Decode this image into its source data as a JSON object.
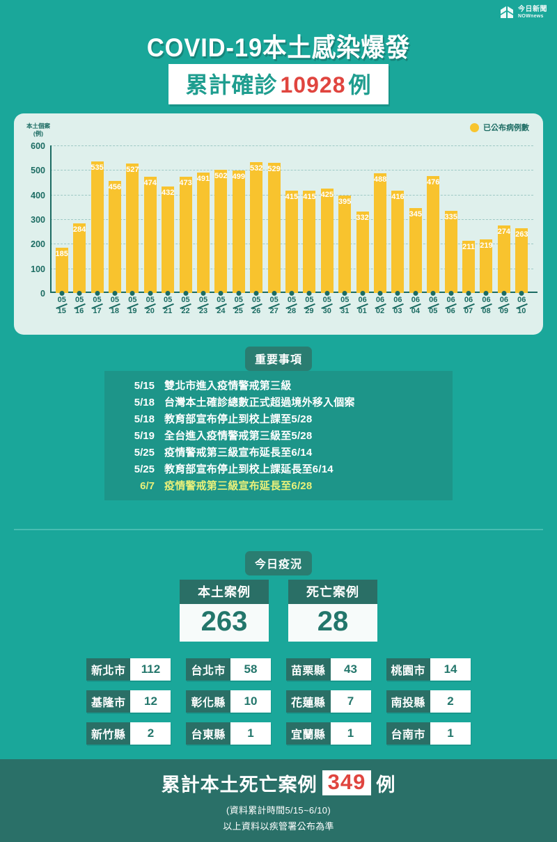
{
  "brand": {
    "logo_cn": "今日新聞",
    "logo_en": "NOWnews"
  },
  "header": {
    "title": "COVID-19本土感染爆發",
    "subtitle_prefix": "累計確診",
    "subtitle_number": "10928",
    "subtitle_suffix": "例",
    "accent_color": "#1f9d8f",
    "highlight_color": "#e0453f"
  },
  "chart_data": {
    "type": "bar",
    "title": "",
    "ylabel": "本土個案",
    "yunit": "(例)",
    "xlabel": "",
    "legend": [
      {
        "label": "已公布病例數",
        "color": "#f8c32e"
      }
    ],
    "legend_position": "top-right",
    "grid": true,
    "ylim": [
      0,
      600
    ],
    "yticks": [
      0,
      100,
      200,
      300,
      400,
      500,
      600
    ],
    "categories": [
      "05/15",
      "05/16",
      "05/17",
      "05/18",
      "05/19",
      "05/20",
      "05/21",
      "05/22",
      "05/23",
      "05/24",
      "05/25",
      "05/26",
      "05/27",
      "05/28",
      "05/29",
      "05/30",
      "05/31",
      "06/01",
      "06/02",
      "06/03",
      "06/04",
      "06/05",
      "06/06",
      "06/07",
      "06/08",
      "06/09",
      "06/10"
    ],
    "values": [
      185,
      284,
      535,
      456,
      527,
      474,
      432,
      473,
      491,
      502,
      499,
      532,
      529,
      415,
      415,
      425,
      395,
      332,
      488,
      416,
      345,
      476,
      335,
      211,
      219,
      274,
      263
    ],
    "bar_color": "#f8c32e",
    "plot_background": "#dff0ec",
    "axis_color": "#1b6b62"
  },
  "events": {
    "heading": "重要事項",
    "rows": [
      {
        "date": "5/15",
        "text": "雙北市進入疫情警戒第三級",
        "highlight": false
      },
      {
        "date": "5/18",
        "text": "台灣本土確診總數正式超過境外移入個案",
        "highlight": false
      },
      {
        "date": "5/18",
        "text": "教育部宣布停止到校上課至5/28",
        "highlight": false
      },
      {
        "date": "5/19",
        "text": "全台進入疫情警戒第三級至5/28",
        "highlight": false
      },
      {
        "date": "5/25",
        "text": "疫情警戒第三級宣布延長至6/14",
        "highlight": false
      },
      {
        "date": "5/25",
        "text": "教育部宣布停止到校上課延長至6/14",
        "highlight": false
      },
      {
        "date": "6/7",
        "text": "疫情警戒第三級宣布延長至6/28",
        "highlight": true
      }
    ],
    "highlight_color": "#e9f07a"
  },
  "today": {
    "heading": "今日疫況",
    "stats": [
      {
        "label": "本土案例",
        "value": "263"
      },
      {
        "label": "死亡案例",
        "value": "28"
      }
    ],
    "cities": [
      [
        {
          "name": "新北市",
          "count": "112"
        },
        {
          "name": "台北市",
          "count": "58"
        },
        {
          "name": "苗栗縣",
          "count": "43"
        },
        {
          "name": "桃園市",
          "count": "14"
        }
      ],
      [
        {
          "name": "基隆市",
          "count": "12"
        },
        {
          "name": "彰化縣",
          "count": "10"
        },
        {
          "name": "花蓮縣",
          "count": "7"
        },
        {
          "name": "南投縣",
          "count": "2"
        }
      ],
      [
        {
          "name": "新竹縣",
          "count": "2"
        },
        {
          "name": "台東縣",
          "count": "1"
        },
        {
          "name": "宜蘭縣",
          "count": "1"
        },
        {
          "name": "台南市",
          "count": "1"
        }
      ]
    ]
  },
  "footer": {
    "main_prefix": "累計本土死亡案例",
    "main_number": "349",
    "main_suffix": "例",
    "note1": "(資料累計時間5/15~6/10)",
    "note2": "以上資料以疾管署公布為準"
  }
}
